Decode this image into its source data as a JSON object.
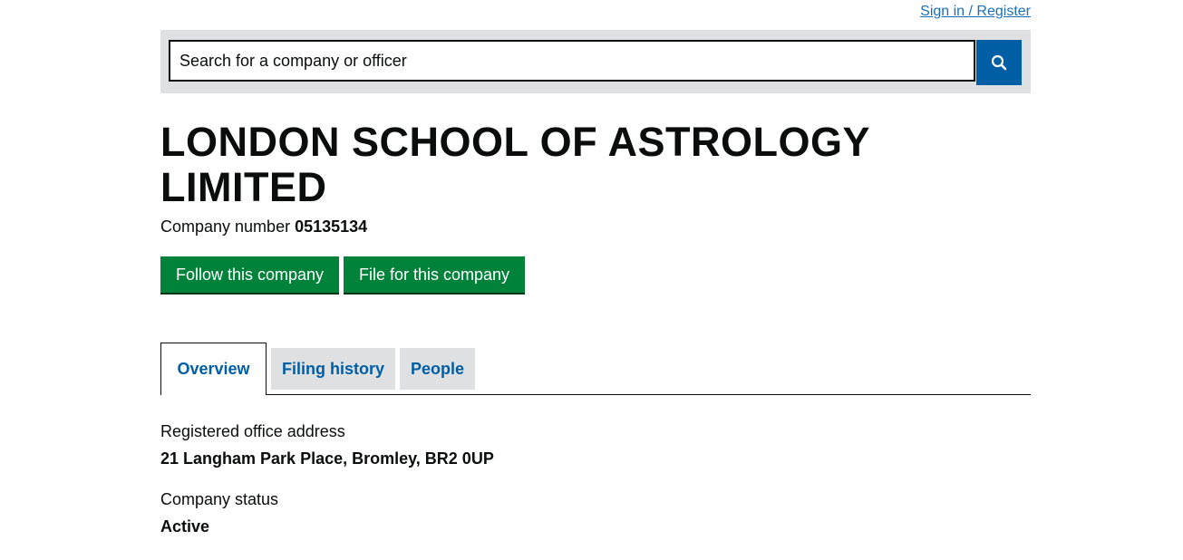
{
  "header": {
    "signin_label": "Sign in / Register"
  },
  "search": {
    "placeholder": "Search for a company or officer",
    "button_icon": "search-icon"
  },
  "company": {
    "title": "LONDON SCHOOL OF ASTROLOGY LIMITED",
    "number_label": "Company number",
    "number": "05135134"
  },
  "actions": {
    "follow_label": "Follow this company",
    "file_label": "File for this company"
  },
  "tabs": [
    {
      "label": "Overview",
      "active": true
    },
    {
      "label": "Filing history",
      "active": false
    },
    {
      "label": "People",
      "active": false
    }
  ],
  "overview": {
    "office_label": "Registered office address",
    "office_value": "21 Langham Park Place, Bromley, BR2 0UP",
    "status_label": "Company status",
    "status_value": "Active"
  },
  "colors": {
    "link": "#1d70b8",
    "button_green": "#00823b",
    "search_blue": "#005ea5",
    "band_grey": "#dee0e2"
  }
}
